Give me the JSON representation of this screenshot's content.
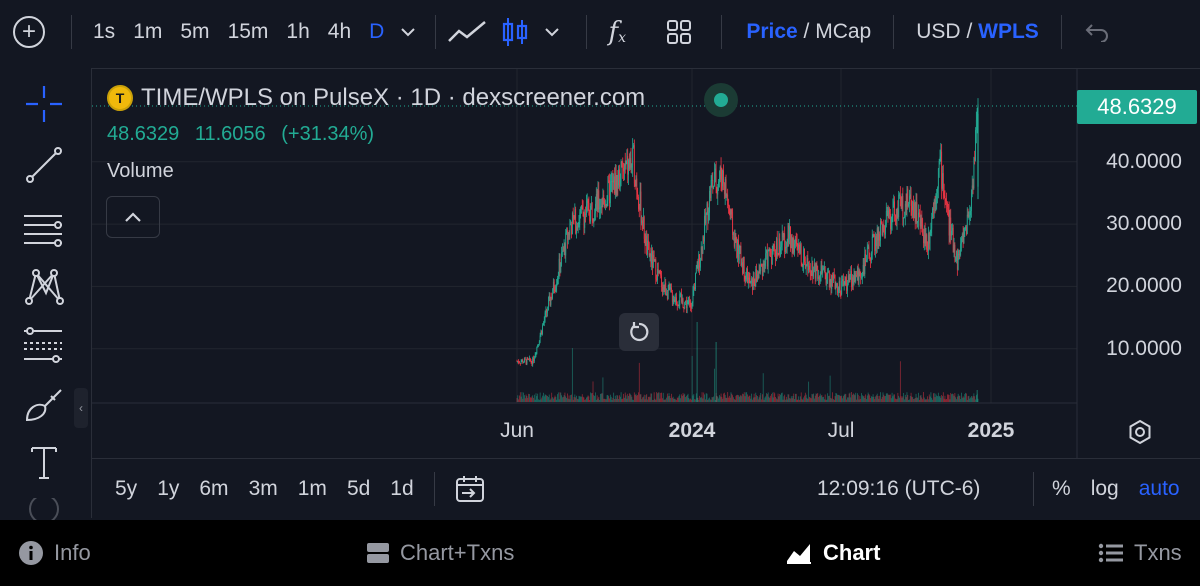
{
  "toolbar": {
    "add_icon": "plus-circle-icon",
    "timeframes": [
      "1s",
      "1m",
      "5m",
      "15m",
      "1h",
      "4h",
      "D"
    ],
    "active_timeframe": "D",
    "price_label": "Price",
    "mcap_label": "MCap",
    "currency_usd": "USD",
    "currency_wpls": "WPLS",
    "slash": "/"
  },
  "chart": {
    "title": "TIME/WPLS on PulseX · 1D · dexscreener.com",
    "last_price": "48.6329",
    "change_abs": "11.6056",
    "change_pct": "(+31.34%)",
    "volume_label": "Volume",
    "y_ticks": [
      "40.0000",
      "30.0000",
      "20.0000",
      "10.0000"
    ],
    "price_tag": "48.6329",
    "x_ticks": [
      {
        "label": "Jun",
        "bold": false
      },
      {
        "label": "2024",
        "bold": true
      },
      {
        "label": "Jul",
        "bold": false
      },
      {
        "label": "2025",
        "bold": true
      }
    ],
    "up_color": "#22ab94",
    "down_color": "#f23645"
  },
  "chart_data": {
    "type": "candlestick",
    "ylim": [
      0,
      52
    ],
    "approx_close_path": [
      {
        "date": "2023-06-01",
        "close": 8
      },
      {
        "date": "2023-06-20",
        "close": 8
      },
      {
        "date": "2023-07-05",
        "close": 15
      },
      {
        "date": "2023-07-20",
        "close": 22
      },
      {
        "date": "2023-08-05",
        "close": 30
      },
      {
        "date": "2023-08-25",
        "close": 32
      },
      {
        "date": "2023-09-15",
        "close": 34
      },
      {
        "date": "2023-10-05",
        "close": 38
      },
      {
        "date": "2023-10-20",
        "close": 40
      },
      {
        "date": "2023-11-05",
        "close": 26
      },
      {
        "date": "2023-11-25",
        "close": 20
      },
      {
        "date": "2023-12-10",
        "close": 18
      },
      {
        "date": "2023-12-28",
        "close": 17
      },
      {
        "date": "2024-01-10",
        "close": 26
      },
      {
        "date": "2024-01-22",
        "close": 36
      },
      {
        "date": "2024-02-05",
        "close": 38
      },
      {
        "date": "2024-02-20",
        "close": 27
      },
      {
        "date": "2024-03-10",
        "close": 20
      },
      {
        "date": "2024-04-01",
        "close": 25
      },
      {
        "date": "2024-04-25",
        "close": 28
      },
      {
        "date": "2024-05-15",
        "close": 24
      },
      {
        "date": "2024-06-05",
        "close": 22
      },
      {
        "date": "2024-06-25",
        "close": 20
      },
      {
        "date": "2024-07-20",
        "close": 22
      },
      {
        "date": "2024-08-10",
        "close": 28
      },
      {
        "date": "2024-08-30",
        "close": 32
      },
      {
        "date": "2024-09-20",
        "close": 34
      },
      {
        "date": "2024-10-10",
        "close": 27
      },
      {
        "date": "2024-10-25",
        "close": 40
      },
      {
        "date": "2024-11-05",
        "close": 30
      },
      {
        "date": "2024-11-15",
        "close": 24
      },
      {
        "date": "2024-12-01",
        "close": 33
      },
      {
        "date": "2024-12-10",
        "close": 48.6
      }
    ]
  },
  "ranges": [
    "5y",
    "1y",
    "6m",
    "3m",
    "1m",
    "5d",
    "1d"
  ],
  "range_bar": {
    "clock": "12:09:16 (UTC-6)",
    "percent": "%",
    "log": "log",
    "auto": "auto"
  },
  "bottom_nav": {
    "info": "Info",
    "chart_txns": "Chart+Txns",
    "chart": "Chart",
    "txns": "Txns"
  }
}
